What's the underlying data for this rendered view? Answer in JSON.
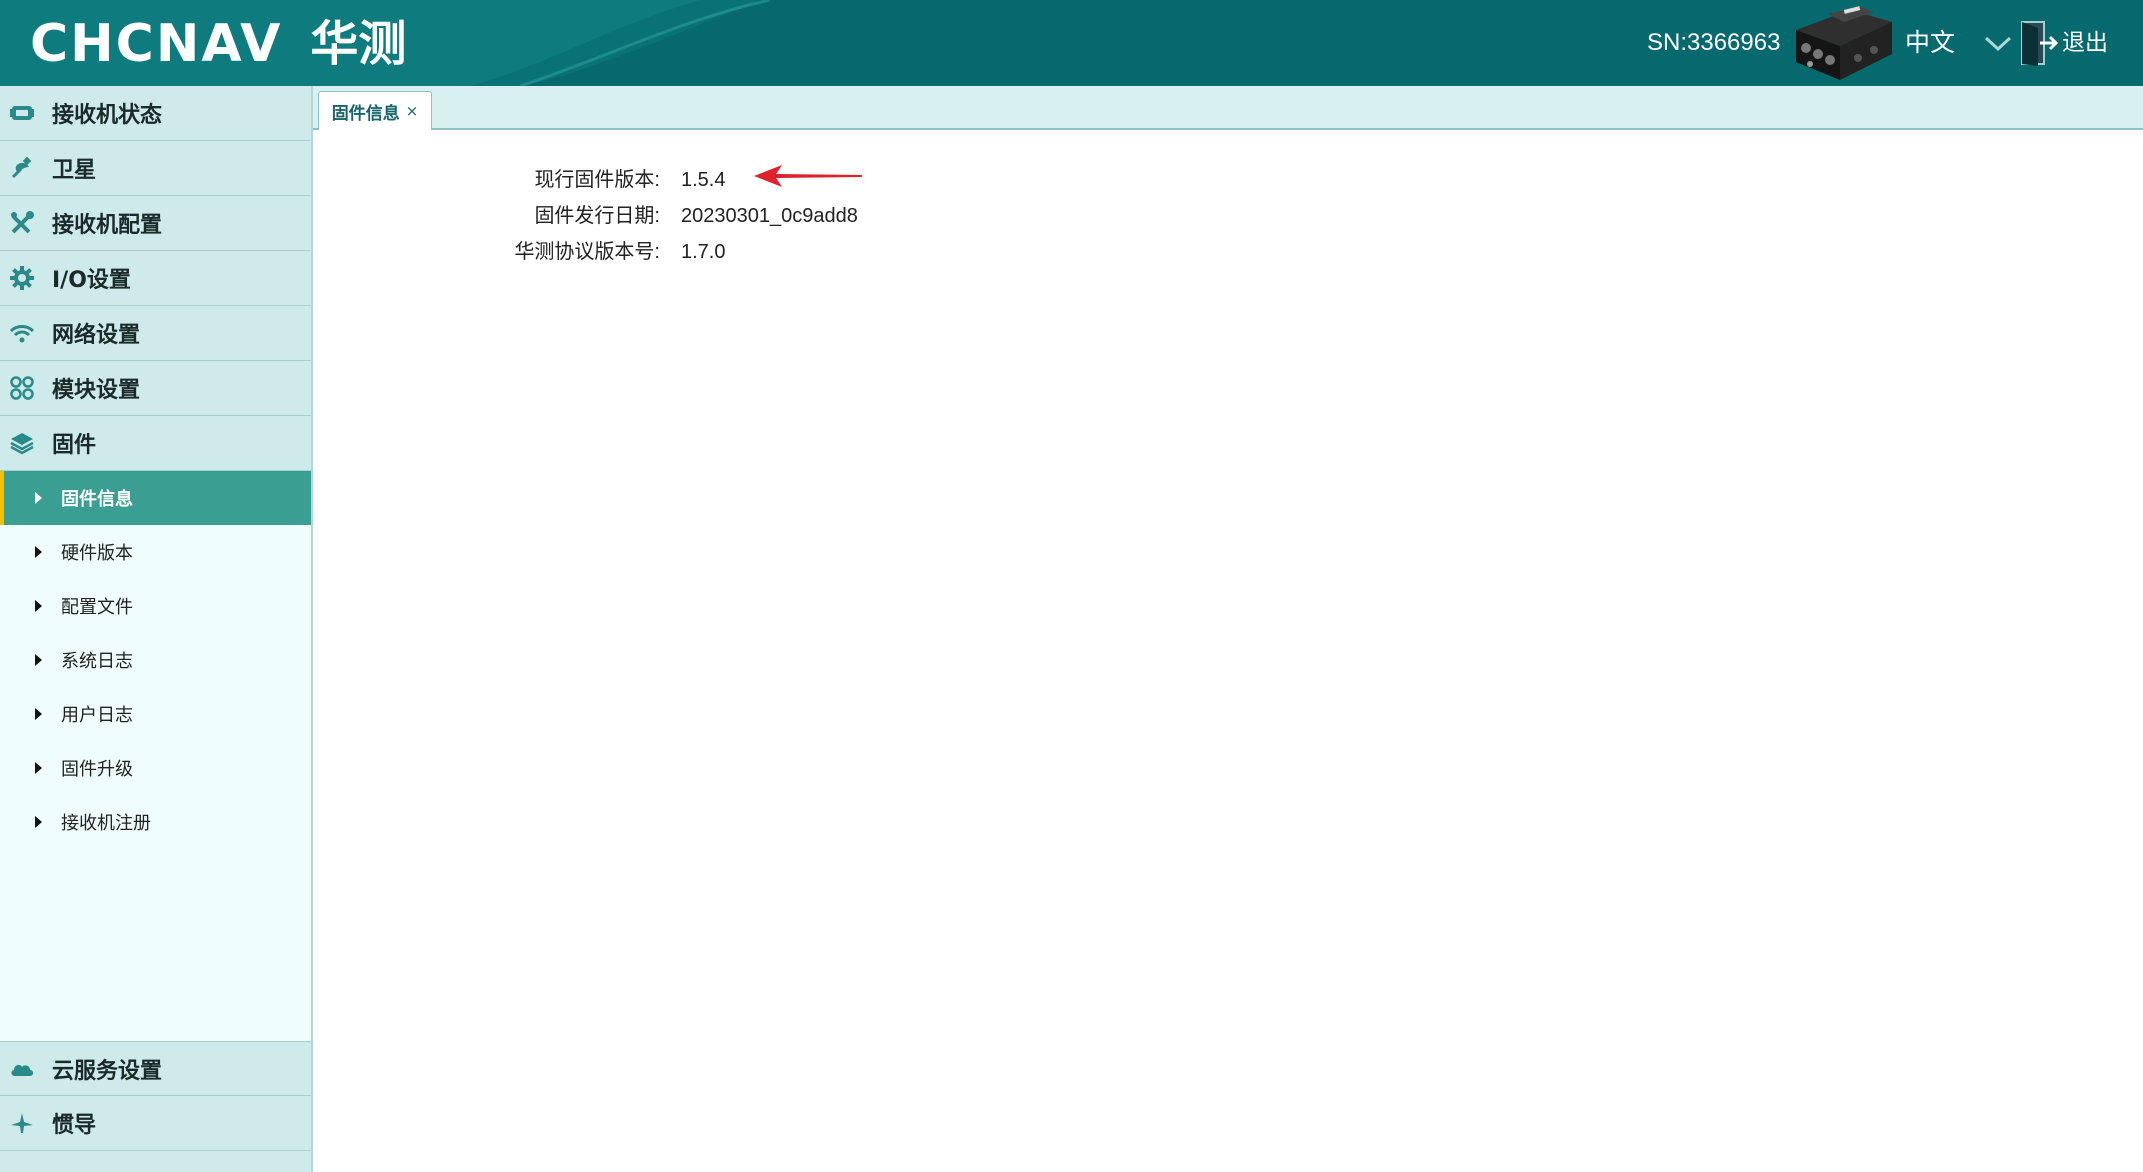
{
  "header": {
    "brand": "CHCNAV",
    "brand_cn": "华测",
    "serial": "SN:3366963",
    "language": "中文",
    "logout_label": "退出",
    "colors": {
      "bar": "#06696e",
      "text": "#ffffff"
    }
  },
  "sidebar": {
    "items": [
      {
        "label": "接收机状态",
        "icon": "receiver-status-icon"
      },
      {
        "label": "卫星",
        "icon": "satellite-icon"
      },
      {
        "label": "接收机配置",
        "icon": "tools-icon"
      },
      {
        "label": "I/O设置",
        "icon": "gear-icon"
      },
      {
        "label": "网络设置",
        "icon": "wifi-icon"
      },
      {
        "label": "模块设置",
        "icon": "modules-icon"
      },
      {
        "label": "固件",
        "icon": "layers-icon"
      }
    ],
    "firmware_subitems": [
      {
        "label": "固件信息",
        "active": true
      },
      {
        "label": "硬件版本"
      },
      {
        "label": "配置文件"
      },
      {
        "label": "系统日志"
      },
      {
        "label": "用户日志"
      },
      {
        "label": "固件升级"
      },
      {
        "label": "接收机注册"
      }
    ],
    "bottom_items": [
      {
        "label": "云服务设置",
        "icon": "cloud-icon"
      },
      {
        "label": "惯导",
        "icon": "ins-icon"
      }
    ],
    "colors": {
      "active": "#3a9e93",
      "active_marker": "#f2c200",
      "item_bg": "#cfeaea"
    }
  },
  "tabs": [
    {
      "label": "固件信息",
      "close": "×"
    }
  ],
  "firmware_info": {
    "rows": [
      {
        "label": "现行固件版本:",
        "value": "1.5.4"
      },
      {
        "label": "固件发行日期:",
        "value": "20230301_0c9add8"
      },
      {
        "label": "华测协议版本号:",
        "value": "1.7.0"
      }
    ],
    "annotation_arrow_color": "#e0202a"
  }
}
